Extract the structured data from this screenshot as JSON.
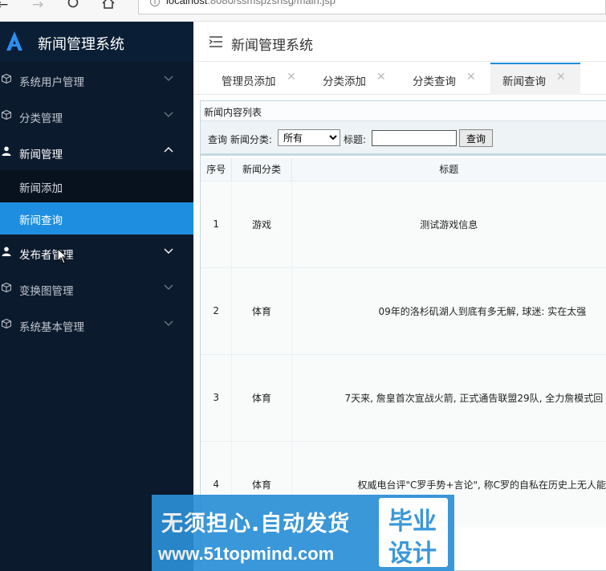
{
  "browser": {
    "url_host": "localhost",
    "url_path": ":8080/ssmspzshsg/main.jsp"
  },
  "app": {
    "title": "新闻管理系统"
  },
  "sidebar": {
    "items": [
      {
        "label": "系统用户管理",
        "icon": "cube-icon"
      },
      {
        "label": "分类管理",
        "icon": "cube-icon"
      },
      {
        "label": "新闻管理",
        "icon": "user-icon",
        "expanded": true
      },
      {
        "label": "发布者管理",
        "icon": "user-icon"
      },
      {
        "label": "变换图管理",
        "icon": "cube-icon"
      },
      {
        "label": "系统基本管理",
        "icon": "cube-icon"
      }
    ],
    "sub_items": [
      {
        "label": "新闻添加"
      },
      {
        "label": "新闻查询",
        "active": true
      }
    ]
  },
  "header": {
    "title": "新闻管理系统"
  },
  "tabs": [
    {
      "label": "管理员添加"
    },
    {
      "label": "分类添加"
    },
    {
      "label": "分类查询"
    },
    {
      "label": "新闻查询",
      "active": true
    }
  ],
  "panel": {
    "title": "新闻内容列表"
  },
  "search": {
    "category_label": "查询 新闻分类:",
    "category_value": "所有",
    "title_label": "标题:",
    "title_value": "",
    "button": "查询"
  },
  "table": {
    "headers": [
      "序号",
      "新闻分类",
      "标题"
    ],
    "rows": [
      [
        "1",
        "游戏",
        "测试游戏信息"
      ],
      [
        "2",
        "体育",
        "09年的洛杉矶湖人到底有多无解, 球迷: 实在太强"
      ],
      [
        "3",
        "体育",
        "7天来, 詹皇首次宣战火箭, 正式通告联盟29队, 全力詹模式回"
      ],
      [
        "4",
        "体育",
        "权威电台评\"C罗手势+言论\", 称C罗的自私在历史上无人能"
      ]
    ]
  },
  "watermark": {
    "line1": "无须担心.自动发货",
    "line2": "www.51topmind.com",
    "badge1": "毕业",
    "badge2": "设计"
  },
  "colors": {
    "sidebar_bg": "#0c1a2d",
    "accent": "#1e8fe0"
  }
}
